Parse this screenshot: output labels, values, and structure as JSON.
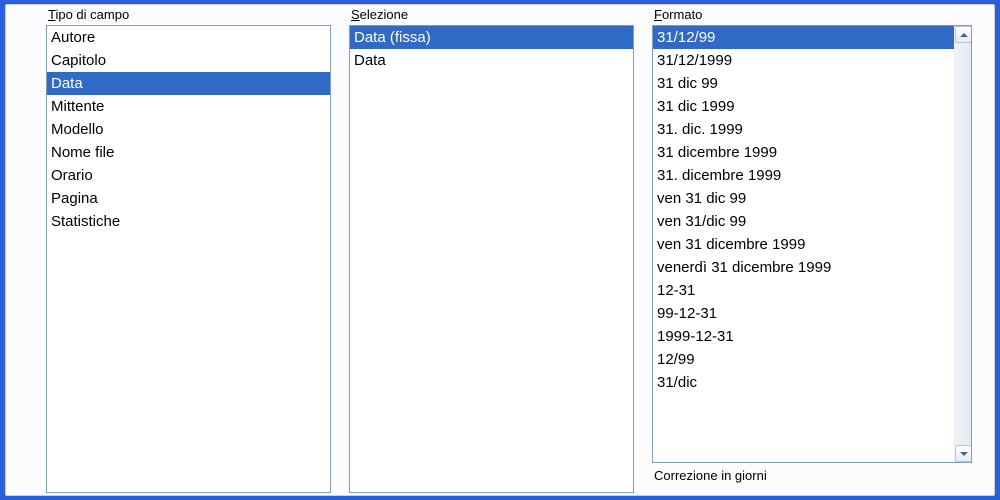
{
  "labels": {
    "tipo": "ipo di campo",
    "tipo_accel": "T",
    "selezione": "elezione",
    "selezione_accel": "S",
    "formato": "ormato",
    "formato_accel": "F",
    "correzione": "orrezione in giorni",
    "correzione_accel": "C"
  },
  "tipo": {
    "items": [
      {
        "label": "Autore",
        "selected": false
      },
      {
        "label": "Capitolo",
        "selected": false
      },
      {
        "label": "Data",
        "selected": true
      },
      {
        "label": "Mittente",
        "selected": false
      },
      {
        "label": "Modello",
        "selected": false
      },
      {
        "label": "Nome file",
        "selected": false
      },
      {
        "label": "Orario",
        "selected": false
      },
      {
        "label": "Pagina",
        "selected": false
      },
      {
        "label": "Statistiche",
        "selected": false
      }
    ]
  },
  "selezione": {
    "items": [
      {
        "label": "Data (fissa)",
        "selected": true
      },
      {
        "label": "Data",
        "selected": false
      }
    ]
  },
  "formato": {
    "items": [
      {
        "label": "31/12/99",
        "selected": true
      },
      {
        "label": "31/12/1999",
        "selected": false
      },
      {
        "label": "31 dic 99",
        "selected": false
      },
      {
        "label": "31 dic 1999",
        "selected": false
      },
      {
        "label": "31. dic. 1999",
        "selected": false
      },
      {
        "label": "31 dicembre 1999",
        "selected": false
      },
      {
        "label": "31. dicembre 1999",
        "selected": false
      },
      {
        "label": "ven 31 dic 99",
        "selected": false
      },
      {
        "label": "ven 31/dic 99",
        "selected": false
      },
      {
        "label": "ven 31 dicembre 1999",
        "selected": false
      },
      {
        "label": "venerdì 31 dicembre 1999",
        "selected": false
      },
      {
        "label": "12-31",
        "selected": false
      },
      {
        "label": "99-12-31",
        "selected": false
      },
      {
        "label": "1999-12-31",
        "selected": false
      },
      {
        "label": "12/99",
        "selected": false
      },
      {
        "label": "31/dic",
        "selected": false
      }
    ]
  }
}
